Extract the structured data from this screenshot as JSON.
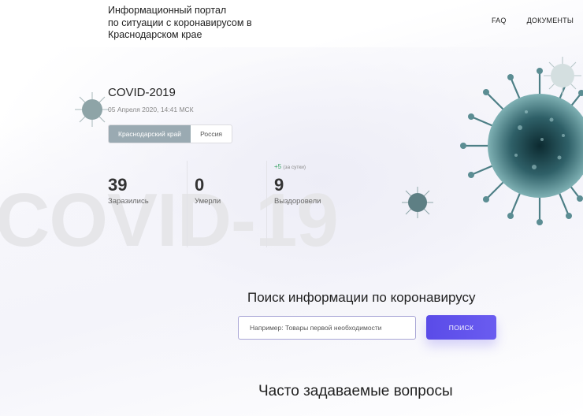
{
  "header": {
    "title_lines": [
      "Информационный портал",
      "по ситуации с коронавирусом в",
      "Краснодарском крае"
    ],
    "nav": [
      {
        "label": "FAQ"
      },
      {
        "label": "ДОКУМЕНТЫ"
      }
    ]
  },
  "background": {
    "watermark": "COVID-19"
  },
  "stats": {
    "title": "COVID-2019",
    "date": "05 Апреля 2020, 14:41 МСК",
    "region_tabs": [
      {
        "label": "Краснодарский край",
        "active": true
      },
      {
        "label": "Россия",
        "active": false
      }
    ],
    "items": [
      {
        "value": "39",
        "label": "Заразились"
      },
      {
        "value": "0",
        "label": "Умерли"
      },
      {
        "value": "9",
        "label": "Выздоровели",
        "delta": "+5",
        "delta_note": "(за сутки)"
      }
    ],
    "delta_color": "#3aa366"
  },
  "search": {
    "title": "Поиск информации по коронавирусу",
    "placeholder": "Например: Товары первой необходимости",
    "value": "",
    "button_label": "ПОИСК",
    "accent_color": "#5a4be8"
  },
  "faq": {
    "title": "Часто задаваемые вопросы"
  },
  "icons": [
    "virus-icon-large",
    "virus-icon-small"
  ]
}
